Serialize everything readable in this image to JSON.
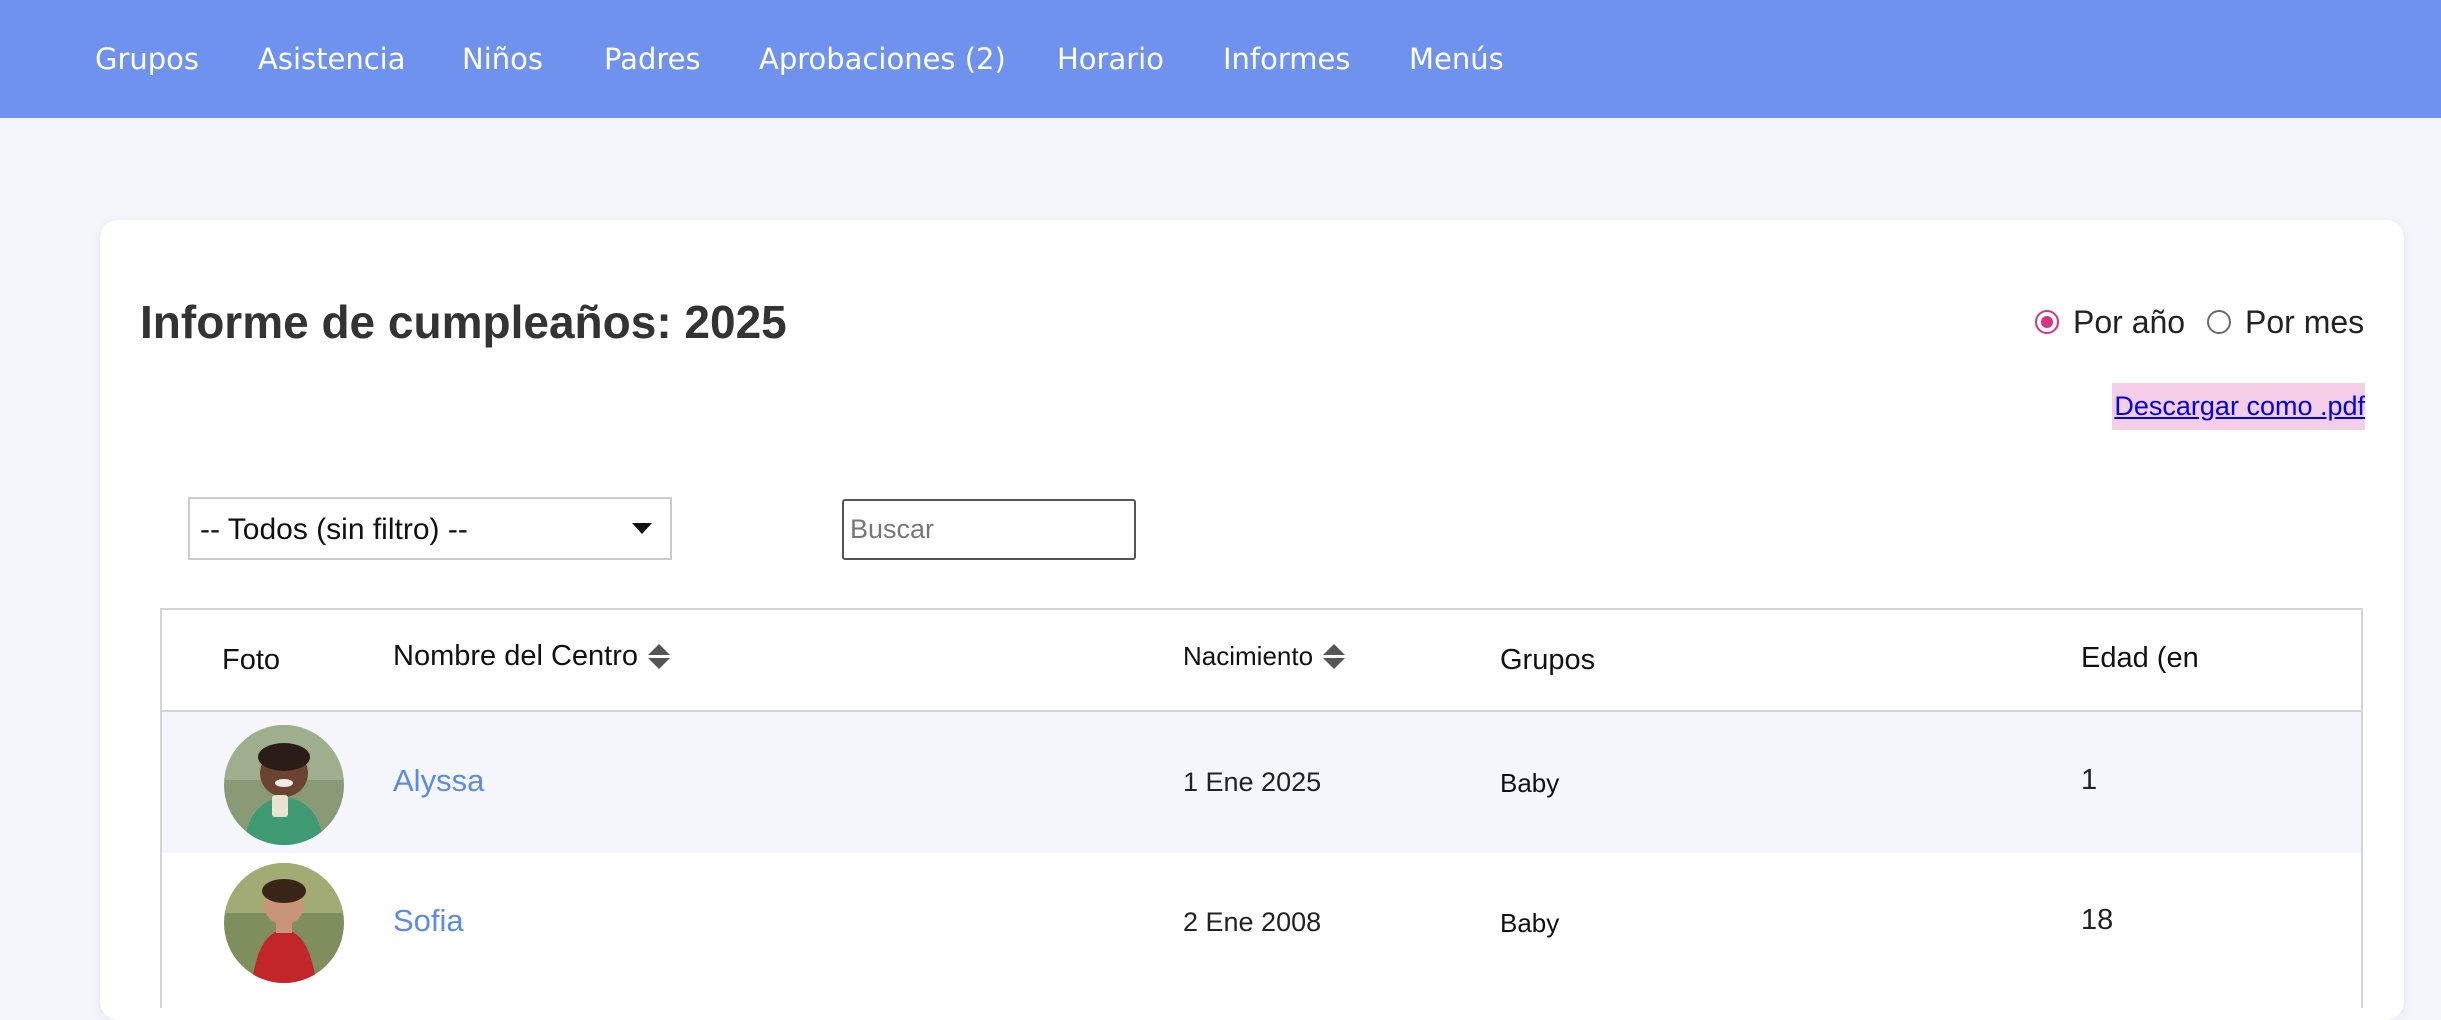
{
  "nav": {
    "items": [
      {
        "label": "Grupos"
      },
      {
        "label": "Asistencia"
      },
      {
        "label": "Niños"
      },
      {
        "label": "Padres"
      },
      {
        "label": "Aprobaciones (2)"
      },
      {
        "label": "Horario"
      },
      {
        "label": "Informes"
      },
      {
        "label": "Menús"
      }
    ]
  },
  "report": {
    "title": "Informe de cumpleaños: 2025",
    "view_options": [
      {
        "label": "Por año",
        "selected": true
      },
      {
        "label": "Por mes",
        "selected": false
      }
    ],
    "download_label": "Descargar como .pdf"
  },
  "filters": {
    "group_select_value": "-- Todos (sin filtro) --",
    "search_placeholder": "Buscar",
    "search_value": ""
  },
  "table": {
    "headers": {
      "photo": "Foto",
      "name": "Nombre del Centro",
      "birth": "Nacimiento",
      "groups": "Grupos",
      "age": "Edad (en"
    },
    "rows": [
      {
        "name": "Alyssa",
        "birth": "1 Ene 2025",
        "group": "Baby",
        "age": "1"
      },
      {
        "name": "Sofia",
        "birth": "2 Ene 2008",
        "group": "Baby",
        "age": "18"
      }
    ]
  },
  "colors": {
    "nav_bg": "#6f92ee",
    "page_bg": "#f3f5fb",
    "link": "#5b8ae8",
    "radio_accent": "#d63384",
    "pdf_highlight": "#f4cde6"
  }
}
